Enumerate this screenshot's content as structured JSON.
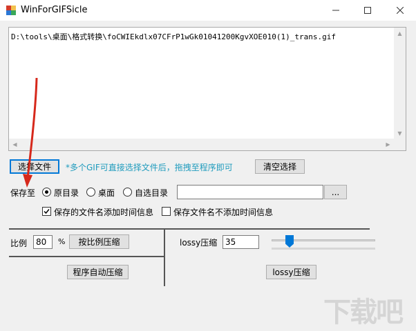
{
  "window": {
    "title": "WinForGIFSicle",
    "minimize": "—",
    "maximize": "☐",
    "close": "✕"
  },
  "file_list": {
    "items": [
      "D:\\tools\\桌面\\格式转换\\foCWIEkdlx07CFrP1wGk01041200KgvXOE010(1)_trans.gif"
    ]
  },
  "buttons": {
    "select_file": "选择文件",
    "clear_selection": "清空选择",
    "browse": "...",
    "scale_compress": "按比例压缩",
    "auto_compress": "程序自动压缩",
    "lossy_compress": "lossy压缩"
  },
  "hint": "*多个GIF可直接选择文件后，拖拽至程序即可",
  "save_to": {
    "label": "保存至",
    "options": [
      "原目录",
      "桌面",
      "自选目录"
    ],
    "selected": "原目录",
    "custom_path": ""
  },
  "filename_options": {
    "add_time": "保存的文件名添加时间信息",
    "add_time_checked": true,
    "no_time": "保存文件名不添加时间信息",
    "no_time_checked": false
  },
  "scale": {
    "label": "比例",
    "value": "80",
    "unit": "%"
  },
  "lossy": {
    "label": "lossy压缩",
    "value": "35",
    "slider_fraction": 0.2
  },
  "watermark": "下载吧",
  "icons": {
    "app": "app-window-icon",
    "check": "checkmark-icon",
    "arrow": "red-arrow-annotation"
  },
  "colors": {
    "accent": "#0078d7",
    "hint": "#1f9bbd",
    "annotation": "#d6281b"
  }
}
